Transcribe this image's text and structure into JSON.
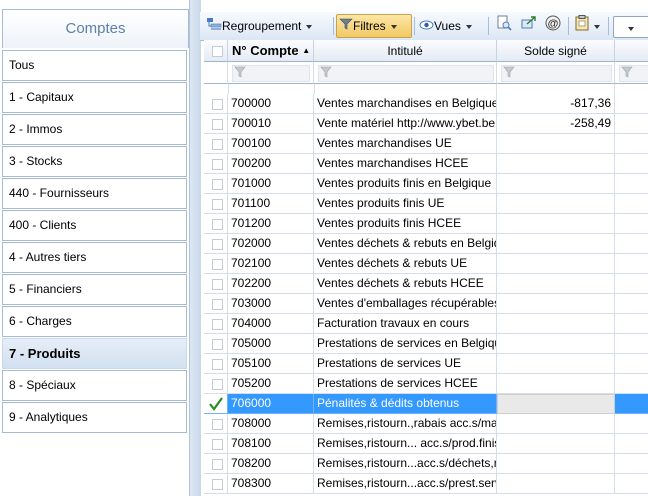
{
  "sidebar": {
    "title": "Comptes",
    "items": [
      {
        "label": "Tous"
      },
      {
        "label": "1 - Capitaux"
      },
      {
        "label": "2 - Immos"
      },
      {
        "label": "3 - Stocks"
      },
      {
        "label": "440 - Fournisseurs"
      },
      {
        "label": "400 - Clients"
      },
      {
        "label": "4 - Autres tiers"
      },
      {
        "label": "5 - Financiers"
      },
      {
        "label": "6 - Charges"
      },
      {
        "label": "7 - Produits"
      },
      {
        "label": "8 - Spéciaux"
      },
      {
        "label": "9 - Analytiques"
      }
    ],
    "active_index": 9
  },
  "toolbar": {
    "regroupement": "Regroupement",
    "filtres": "Filtres",
    "vues": "Vues"
  },
  "grid": {
    "columns": {
      "account": "N° Compte",
      "label": "Intitulé",
      "balance": "Solde signé"
    },
    "selected_index": 15,
    "rows": [
      {
        "account": "700000",
        "label": "Ventes marchandises en Belgique",
        "balance": "-817,36"
      },
      {
        "account": "700010",
        "label": "Vente matériel http://www.ybet.be",
        "balance": "-258,49"
      },
      {
        "account": "700100",
        "label": "Ventes marchandises UE",
        "balance": ""
      },
      {
        "account": "700200",
        "label": "Ventes marchandises HCEE",
        "balance": ""
      },
      {
        "account": "701000",
        "label": "Ventes produits finis en Belgique",
        "balance": ""
      },
      {
        "account": "701100",
        "label": "Ventes produits finis UE",
        "balance": ""
      },
      {
        "account": "701200",
        "label": "Ventes produits finis HCEE",
        "balance": ""
      },
      {
        "account": "702000",
        "label": "Ventes déchets & rebuts en Belgique",
        "balance": ""
      },
      {
        "account": "702100",
        "label": "Ventes déchets & rebuts UE",
        "balance": ""
      },
      {
        "account": "702200",
        "label": "Ventes déchets & rebuts HCEE",
        "balance": ""
      },
      {
        "account": "703000",
        "label": "Ventes d'emballages récupérables",
        "balance": ""
      },
      {
        "account": "704000",
        "label": "Facturation travaux en cours",
        "balance": ""
      },
      {
        "account": "705000",
        "label": "Prestations de services en Belgique",
        "balance": ""
      },
      {
        "account": "705100",
        "label": "Prestations de services UE",
        "balance": ""
      },
      {
        "account": "705200",
        "label": "Prestations de services HCEE",
        "balance": ""
      },
      {
        "account": "706000",
        "label": "Pénalités & dédits obtenus",
        "balance": ""
      },
      {
        "account": "708000",
        "label": "Remises,ristourn.,rabais acc.s/marchandises",
        "balance": ""
      },
      {
        "account": "708100",
        "label": "Remises,ristourn... acc.s/prod.finis",
        "balance": ""
      },
      {
        "account": "708200",
        "label": "Remises,ristourn...acc.s/déchets,rebuts",
        "balance": ""
      },
      {
        "account": "708300",
        "label": "Remises,ristourn...acc.s/prest.services",
        "balance": ""
      }
    ]
  }
}
